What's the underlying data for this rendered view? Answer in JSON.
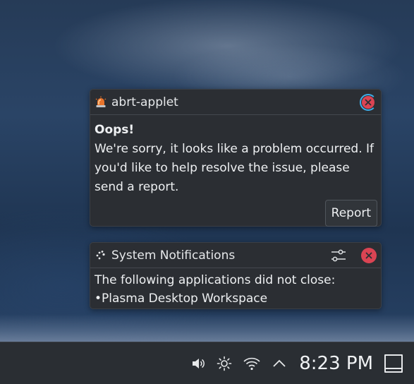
{
  "notifications": [
    {
      "app_name": "abrt-applet",
      "app_icon": "siren-icon",
      "title": "Oops!",
      "message": "We're sorry, it looks like a problem occurred. If you'd like to help resolve the issue, please send a report.",
      "action_label": "Report",
      "close_icon": "close-icon"
    },
    {
      "app_name": "System Notifications",
      "app_icon": "notification-sparkle-icon",
      "message_line1": "The following applications did not close:",
      "message_line2": "•Plasma Desktop Workspace",
      "settings_icon": "settings-sliders-icon",
      "close_icon": "close-icon"
    }
  ],
  "taskbar": {
    "tray_icons": [
      "volume-icon",
      "brightness-icon",
      "wifi-icon",
      "expand-tray-icon"
    ],
    "clock": "8:23 PM",
    "show_desktop_icon": "show-desktop-icon"
  },
  "colors": {
    "close_red": "#da4453",
    "panel_bg": "#2a2e33",
    "notification_bg": "#2b2e33",
    "progress_ring": "#3daee9"
  }
}
